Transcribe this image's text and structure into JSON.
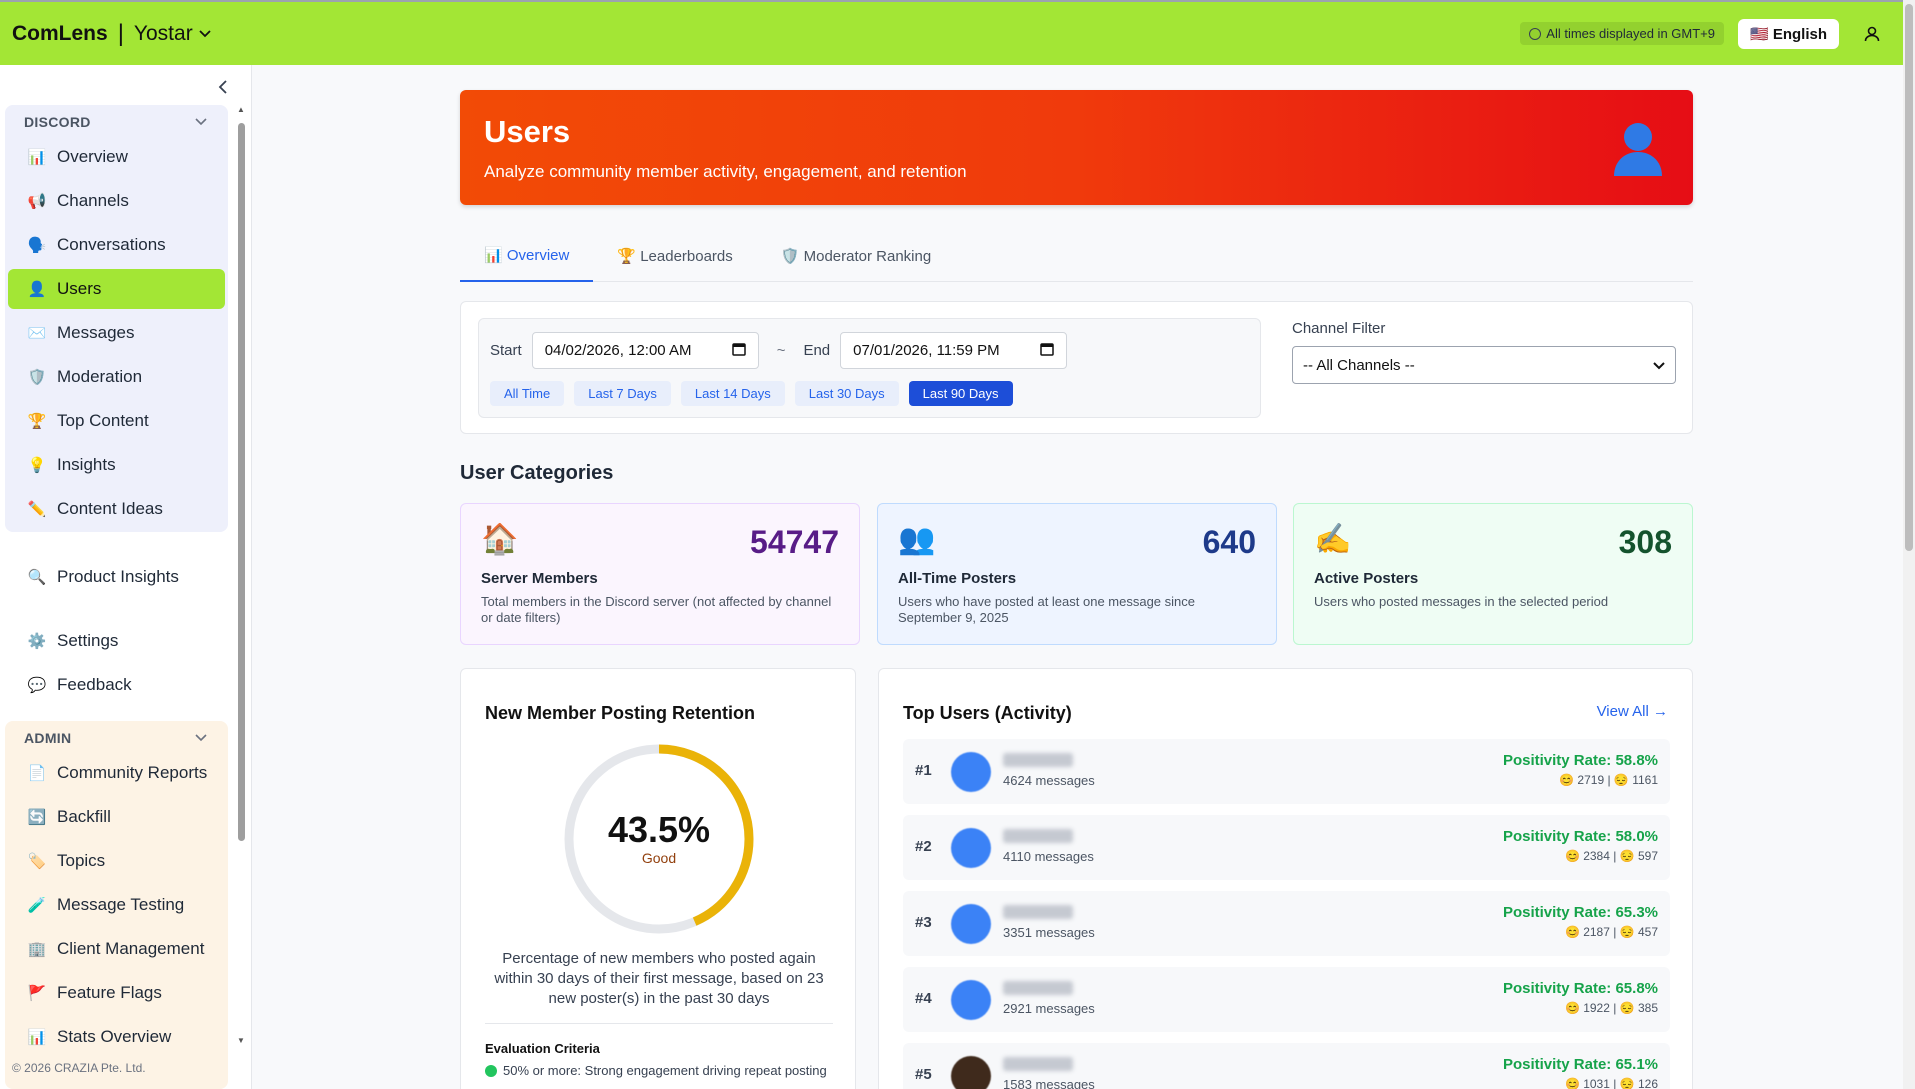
{
  "header": {
    "brand": "ComLens",
    "separator": "|",
    "org": "Yostar",
    "timezone_note": "All times displayed in GMT+9",
    "language": "🇺🇸 English"
  },
  "sidebar": {
    "discord_group": "DISCORD",
    "discord_items": [
      {
        "icon": "📊",
        "label": "Overview"
      },
      {
        "icon": "📢",
        "label": "Channels"
      },
      {
        "icon": "🗣️",
        "label": "Conversations"
      },
      {
        "icon": "👤",
        "label": "Users"
      },
      {
        "icon": "✉️",
        "label": "Messages"
      },
      {
        "icon": "🛡️",
        "label": "Moderation"
      },
      {
        "icon": "🏆",
        "label": "Top Content"
      },
      {
        "icon": "💡",
        "label": "Insights"
      },
      {
        "icon": "✏️",
        "label": "Content Ideas"
      }
    ],
    "product_insights": {
      "icon": "🔍",
      "label": "Product Insights"
    },
    "settings": {
      "icon": "⚙️",
      "label": "Settings"
    },
    "feedback": {
      "icon": "💬",
      "label": "Feedback"
    },
    "admin_group": "ADMIN",
    "admin_items": [
      {
        "icon": "📄",
        "label": "Community Reports"
      },
      {
        "icon": "🔄",
        "label": "Backfill"
      },
      {
        "icon": "🏷️",
        "label": "Topics"
      },
      {
        "icon": "🧪",
        "label": "Message Testing"
      },
      {
        "icon": "🏢",
        "label": "Client Management"
      },
      {
        "icon": "🚩",
        "label": "Feature Flags"
      },
      {
        "icon": "📊",
        "label": "Stats Overview"
      }
    ],
    "footer": "© 2026 CRAZIA Pte. Ltd."
  },
  "hero": {
    "title": "Users",
    "subtitle": "Analyze community member activity, engagement, and retention"
  },
  "tabs": [
    {
      "label": "📊 Overview"
    },
    {
      "label": "🏆 Leaderboards"
    },
    {
      "label": "🛡️ Moderator Ranking"
    }
  ],
  "filters": {
    "start_label": "Start",
    "start_value": "04/02/2026, 12:00 AM",
    "tilde": "~",
    "end_label": "End",
    "end_value": "07/01/2026, 11:59 PM",
    "ranges": [
      "All Time",
      "Last 7 Days",
      "Last 14 Days",
      "Last 30 Days",
      "Last 90 Days"
    ],
    "active_range": "Last 90 Days",
    "channel_label": "Channel Filter",
    "channel_value": "-- All Channels --"
  },
  "categories_title": "User Categories",
  "categories": [
    {
      "emoji": "🏠",
      "value": "54747",
      "label": "Server Members",
      "desc": "Total members in the Discord server (not affected by channel or date filters)"
    },
    {
      "emoji": "👥",
      "value": "640",
      "label": "All-Time Posters",
      "desc": "Users who have posted at least one message since September 9, 2025"
    },
    {
      "emoji": "✍️",
      "value": "308",
      "label": "Active Posters",
      "desc": "Users who posted messages in the selected period"
    }
  ],
  "retention": {
    "title": "New Member Posting Retention",
    "percent_text": "43.5%",
    "percent_value": 43.5,
    "rating": "Good",
    "description": "Percentage of new members who posted again within 30 days of their first message, based on 23 new poster(s) in the past 30 days",
    "eval_title": "Evaluation Criteria",
    "eval_first": "50% or more: Strong engagement driving repeat posting",
    "ring_color": "#eab308",
    "track_color": "#e5e7eb"
  },
  "top_users": {
    "title": "Top Users (Activity)",
    "view_all": "View All →",
    "rows": [
      {
        "rank": "#1",
        "messages": "4624 messages",
        "rate": "Positivity Rate: 58.8%",
        "counts": "😊 2719 | 😔 1161"
      },
      {
        "rank": "#2",
        "messages": "4110 messages",
        "rate": "Positivity Rate: 58.0%",
        "counts": "😊 2384 | 😔 597"
      },
      {
        "rank": "#3",
        "messages": "3351 messages",
        "rate": "Positivity Rate: 65.3%",
        "counts": "😊 2187 | 😔 457"
      },
      {
        "rank": "#4",
        "messages": "2921 messages",
        "rate": "Positivity Rate: 65.8%",
        "counts": "😊 1922 | 😔 385"
      },
      {
        "rank": "#5",
        "messages": "1583 messages",
        "rate": "Positivity Rate: 65.1%",
        "counts": "😊 1031 | 😔 126"
      }
    ]
  }
}
